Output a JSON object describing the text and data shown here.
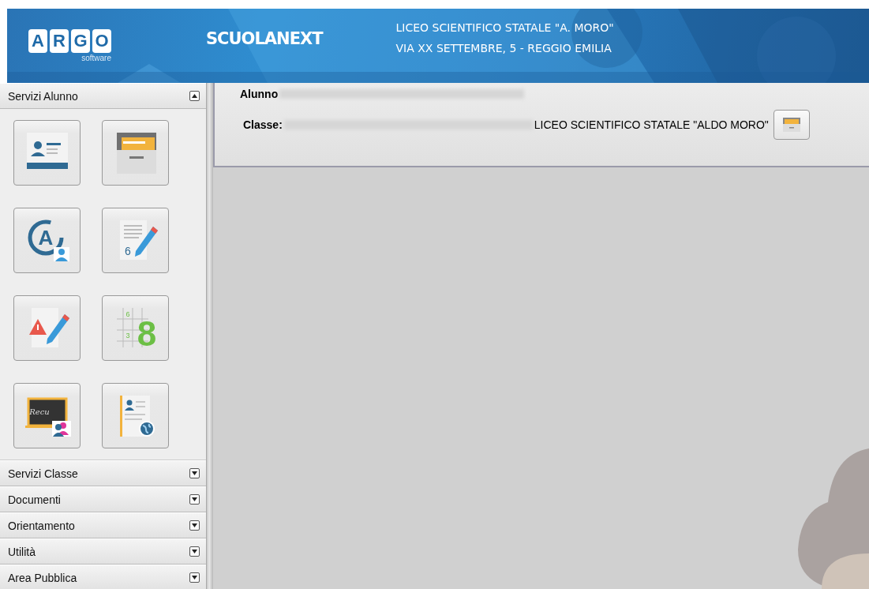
{
  "header": {
    "logo_letters": [
      "A",
      "R",
      "G",
      "O"
    ],
    "logo_caption": "software",
    "product": "SCUOLANEXT",
    "school_name": "LICEO SCIENTIFICO STATALE \"A. MORO\"",
    "school_address": "VIA XX SETTEMBRE, 5 - REGGIO EMILIA"
  },
  "sidebar": {
    "sections": [
      {
        "label": "Servizi Alunno",
        "expanded": true,
        "tiles": [
          {
            "kind": "student-card"
          },
          {
            "kind": "archive"
          },
          {
            "kind": "absences",
            "text": "A"
          },
          {
            "kind": "grade-entry",
            "text": "6"
          },
          {
            "kind": "notes"
          },
          {
            "kind": "grades",
            "texts": [
              "6",
              "3",
              "8"
            ]
          },
          {
            "kind": "recovery",
            "text": "Recu"
          },
          {
            "kind": "profile"
          }
        ]
      },
      {
        "label": "Servizi Classe",
        "expanded": false
      },
      {
        "label": "Documenti",
        "expanded": false
      },
      {
        "label": "Orientamento",
        "expanded": false
      },
      {
        "label": "Utilità",
        "expanded": false
      },
      {
        "label": "Area Pubblica",
        "expanded": false
      }
    ]
  },
  "student": {
    "student_label": "Alunno",
    "class_label": "Classe:",
    "school": "LICEO SCIENTIFICO STATALE \"ALDO MORO\""
  }
}
